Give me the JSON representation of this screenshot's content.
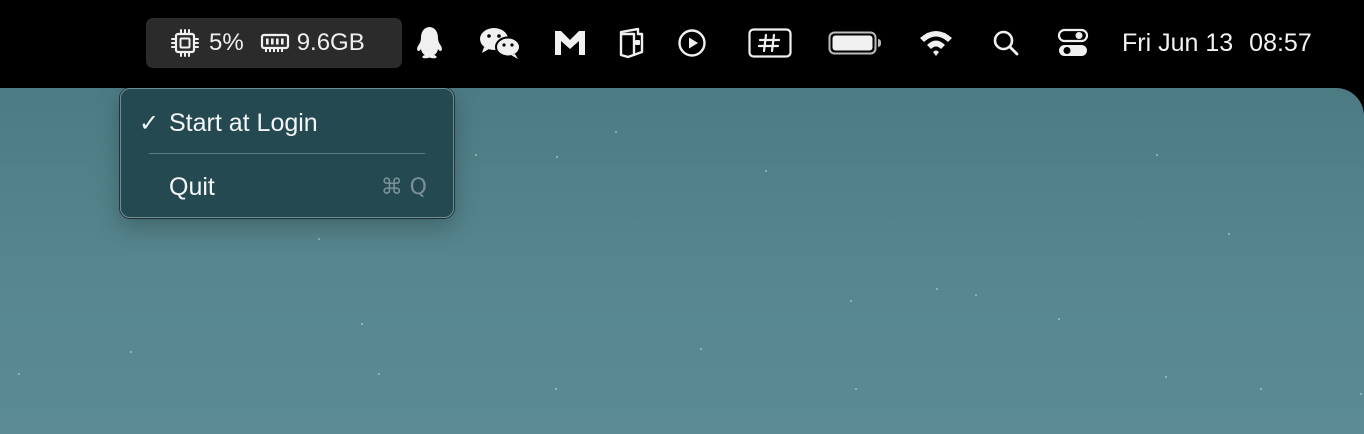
{
  "menubar": {
    "stats": {
      "cpu_icon": "cpu-chip-icon",
      "cpu": "5%",
      "memory_icon": "ram-module-icon",
      "memory": "9.6GB"
    },
    "status_icons": [
      "qq-penguin-icon",
      "wechat-icon",
      "cat-mail-icon",
      "wallet-icon",
      "play-circle-icon",
      "hashtag-box-icon",
      "battery-icon",
      "wifi-icon",
      "search-icon",
      "control-center-icon"
    ],
    "date": "Fri Jun 13",
    "time": "08:57"
  },
  "dropdown_menu": {
    "items": [
      {
        "label": "Start at Login",
        "checked": true,
        "check_mark": "✓"
      },
      {
        "label": "Quit",
        "shortcut": "⌘ Q"
      }
    ]
  },
  "colors": {
    "menubar_bg": "#000000",
    "desktop": "#58878f",
    "menu_bg": "#22444c"
  }
}
